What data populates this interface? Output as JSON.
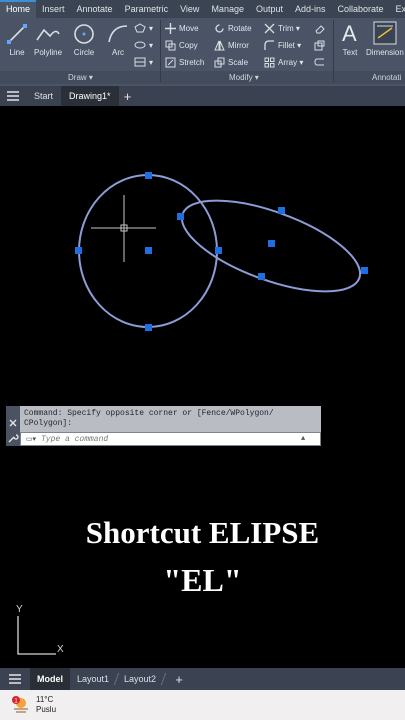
{
  "ribbon_tabs": [
    "Home",
    "Insert",
    "Annotate",
    "Parametric",
    "View",
    "Manage",
    "Output",
    "Add-ins",
    "Collaborate",
    "Ex"
  ],
  "draw_panel": {
    "title": "Draw",
    "tools": [
      "Line",
      "Polyline",
      "Circle",
      "Arc"
    ]
  },
  "modify_panel": {
    "title": "Modify",
    "tools": [
      "Move",
      "Rotate",
      "Trim",
      "Copy",
      "Mirror",
      "Fillet",
      "Stretch",
      "Scale",
      "Array"
    ]
  },
  "annotation_panel": {
    "title": "Annotati",
    "tools": [
      "Text",
      "Dimension"
    ]
  },
  "doc_tabs": [
    "Start",
    "Drawing1*"
  ],
  "command": {
    "history": "Command: Specify opposite corner or [Fence/WPolygon/ CPolygon]:",
    "placeholder": "Type a command"
  },
  "caption": {
    "line1": "Shortcut ELIPSE",
    "line2": "\"EL\""
  },
  "ucs": {
    "y": "Y",
    "x": "X"
  },
  "layout_tabs": [
    "Model",
    "Layout1",
    "Layout2"
  ],
  "taskbar": {
    "temperature": "11°C",
    "condition": "Puslu",
    "badge": "1"
  },
  "colors": {
    "ellipse": "#8d9cd6",
    "grip": "#1f6fe0",
    "ribbon": "#4a5466",
    "canvas": "#000000"
  }
}
